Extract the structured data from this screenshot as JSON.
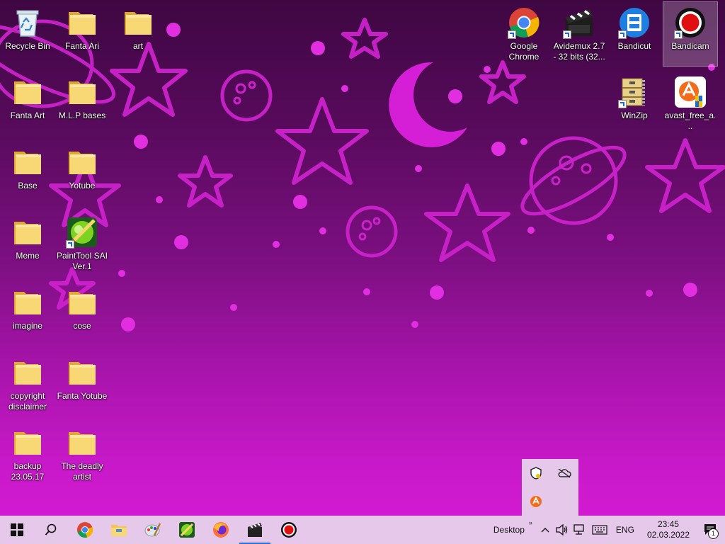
{
  "desktop": {
    "icons": [
      {
        "label": "Recycle Bin",
        "icon": "recycle-bin-icon"
      },
      {
        "label": "Fanta Ari",
        "icon": "folder-icon"
      },
      {
        "label": "art",
        "icon": "folder-icon"
      },
      {
        "label": "Fanta Art",
        "icon": "folder-icon"
      },
      {
        "label": "M.L.P bases",
        "icon": "folder-icon"
      },
      {
        "label": "Base",
        "icon": "folder-icon"
      },
      {
        "label": "Yotube",
        "icon": "folder-icon"
      },
      {
        "label": "Meme",
        "icon": "folder-icon"
      },
      {
        "label": "PaintTool SAI Ver.1",
        "icon": "painttool-sai-icon"
      },
      {
        "label": "imagine",
        "icon": "folder-icon"
      },
      {
        "label": "cose",
        "icon": "folder-icon"
      },
      {
        "label": "copyright disclaimer",
        "icon": "folder-icon"
      },
      {
        "label": "Fanta Yotube",
        "icon": "folder-icon"
      },
      {
        "label": "backup 23.05.17",
        "icon": "folder-icon"
      },
      {
        "label": "The deadly artist",
        "icon": "folder-icon"
      },
      {
        "label": "Google Chrome",
        "icon": "chrome-icon"
      },
      {
        "label": "Avidemux 2.7 - 32 bits (32...",
        "icon": "avidemux-icon"
      },
      {
        "label": "Bandicut",
        "icon": "bandicut-icon"
      },
      {
        "label": "Bandicam",
        "icon": "bandicam-icon"
      },
      {
        "label": "WinZip",
        "icon": "winzip-icon"
      },
      {
        "label": "avast_free_a...",
        "icon": "avast-installer-icon"
      }
    ]
  },
  "taskbar": {
    "pinned": [
      "start-icon",
      "search-icon",
      "chrome-icon",
      "file-explorer-icon",
      "paint-icon",
      "painttool-sai-icon",
      "firefox-icon",
      "avidemux-icon",
      "bandicam-icon"
    ],
    "desktop_label": "Desktop",
    "language": "ENG",
    "time": "23:45",
    "date": "02.03.2022",
    "notification_count": "1"
  },
  "tray_popup": {
    "items": [
      "defender-icon",
      "onedrive-offline-icon",
      "avast-icon"
    ]
  },
  "colors": {
    "taskbar_bg": "#e6c8ea",
    "wallpaper_shape": "#d41fd6",
    "folder": "#f5c451"
  }
}
